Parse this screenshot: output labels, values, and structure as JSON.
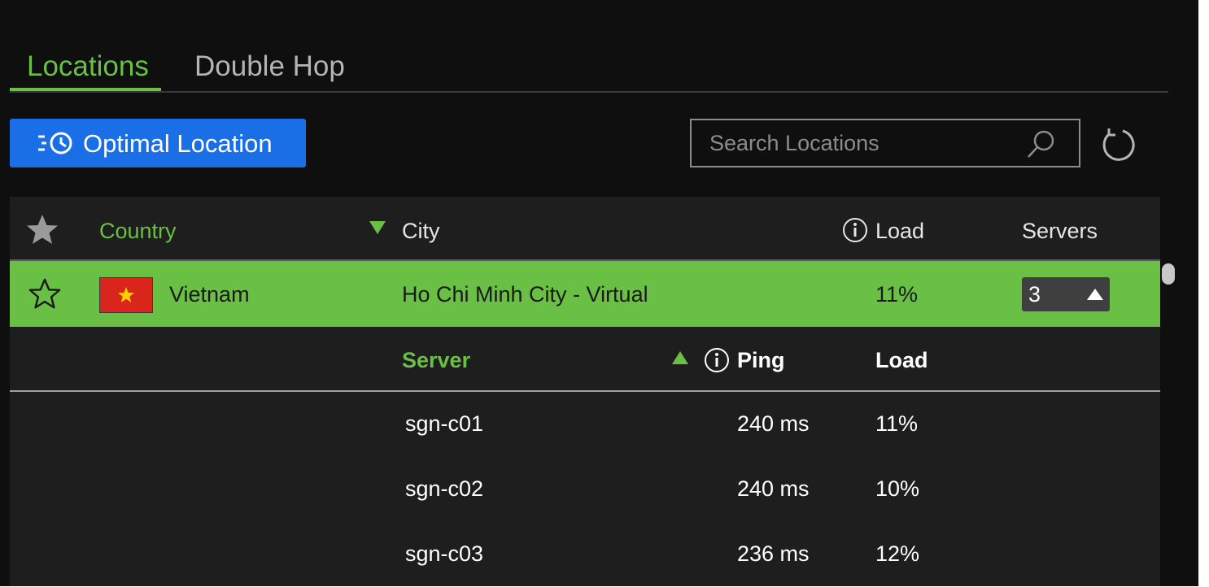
{
  "tabs": [
    {
      "label": "Locations",
      "active": true
    },
    {
      "label": "Double Hop",
      "active": false
    }
  ],
  "toolbar": {
    "optimal_label": "Optimal Location",
    "search_placeholder": "Search Locations",
    "search_value": ""
  },
  "table": {
    "headers": {
      "country": "Country",
      "city": "City",
      "load": "Load",
      "servers": "Servers"
    },
    "selected_location": {
      "country": "Vietnam",
      "city": "Ho Chi Minh City - Virtual",
      "load": "11%",
      "servers_count": "3",
      "favorite": false
    },
    "server_headers": {
      "server": "Server",
      "ping": "Ping",
      "load": "Load"
    },
    "servers": [
      {
        "name": "sgn-c01",
        "ping": "240 ms",
        "load": "11%"
      },
      {
        "name": "sgn-c02",
        "ping": "240 ms",
        "load": "10%"
      },
      {
        "name": "sgn-c03",
        "ping": "236 ms",
        "load": "12%"
      }
    ]
  },
  "colors": {
    "accent_green": "#6abf45",
    "button_blue": "#1a6fe6",
    "background": "#0f0f0f",
    "table_background": "#1e1e1e",
    "flag_red": "#da251d",
    "flag_star": "#ffcd00"
  },
  "icons": {
    "optimal": "clock-list-icon",
    "search": "search-icon",
    "refresh": "refresh-icon",
    "favorite_header": "star-filled-icon",
    "favorite_row": "star-outline-icon",
    "info": "info-icon",
    "sort_desc": "sort-down-icon",
    "sort_asc": "sort-up-icon",
    "dropdown": "caret-up-icon",
    "flag": "vietnam-flag-icon"
  }
}
